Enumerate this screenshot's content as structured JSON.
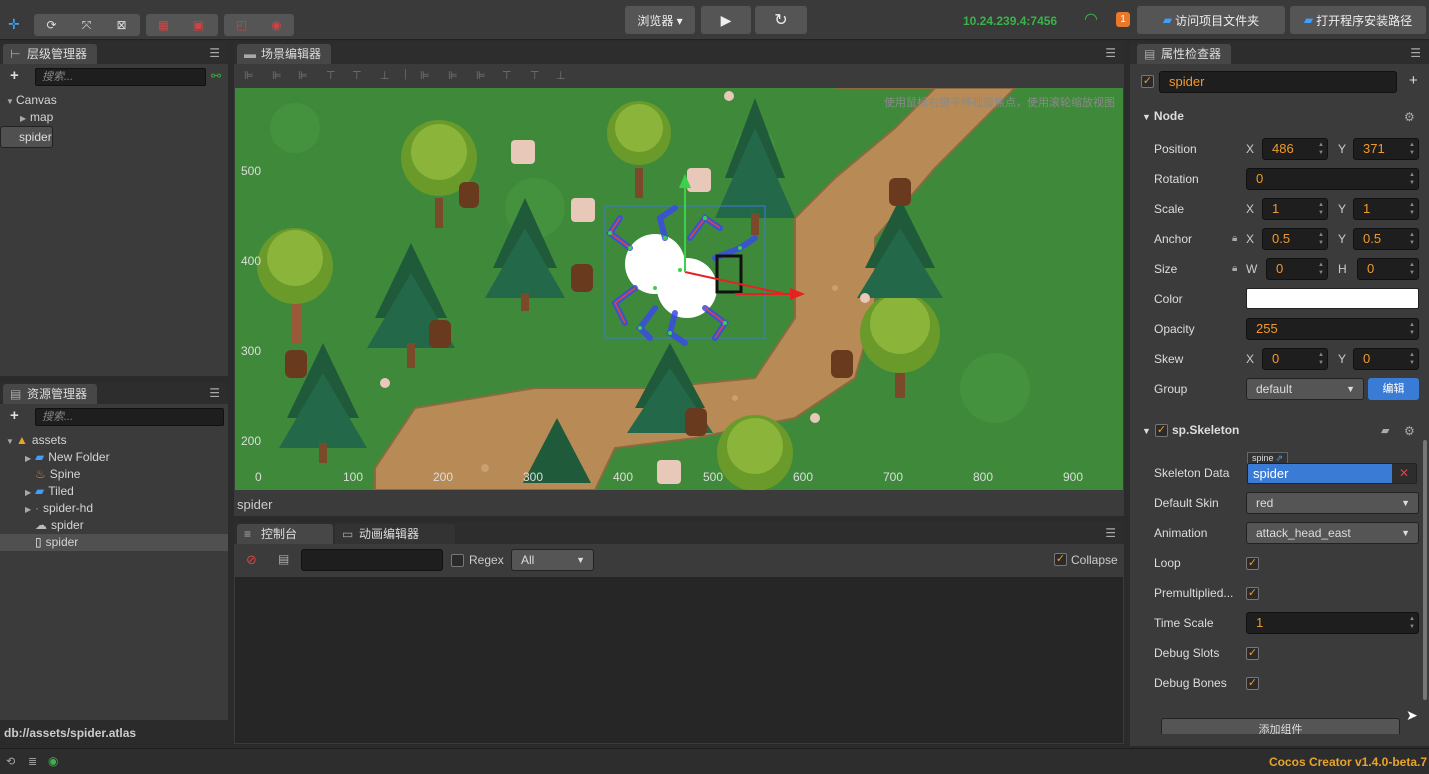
{
  "toolbar": {
    "tool_icons": [
      "move-icon",
      "rotate-icon",
      "scale-icon",
      "rect-icon"
    ],
    "browser_select": "浏览器 ▾",
    "ip": "10.24.239.4:7456",
    "badge": "1",
    "open_project_folder": "访问项目文件夹",
    "open_install_path": "打开程序安装路径"
  },
  "hierarchy": {
    "title": "层级管理器",
    "search_placeholder": "搜索...",
    "nodes": [
      "Canvas",
      "map",
      "spider"
    ]
  },
  "assets": {
    "title": "资源管理器",
    "search_placeholder": "搜索...",
    "items": [
      "assets",
      "New Folder",
      "Spine",
      "Tiled",
      "spider-hd",
      "spider",
      "spider"
    ],
    "path": "db://assets/spider.atlas"
  },
  "scene": {
    "title": "场景编辑器",
    "hint": "使用鼠标右键平移视窗焦点，使用滚轮缩放视图",
    "selected_node": "spider",
    "y_ticks": [
      "500",
      "400",
      "300",
      "200"
    ],
    "x_ticks": [
      "0",
      "100",
      "200",
      "300",
      "400",
      "500",
      "600",
      "700",
      "800",
      "900"
    ]
  },
  "console": {
    "tab_console": "控制台",
    "tab_animation": "动画编辑器",
    "regex_label": "Regex",
    "filter_option": "All",
    "collapse_label": "Collapse"
  },
  "inspector": {
    "title": "属性检查器",
    "node_name": "spider",
    "node_section": "Node",
    "position_label": "Position",
    "pos_x": "486",
    "pos_y": "371",
    "rotation_label": "Rotation",
    "rotation": "0",
    "scale_label": "Scale",
    "scale_x": "1",
    "scale_y": "1",
    "anchor_label": "Anchor",
    "anchor_x": "0.5",
    "anchor_y": "0.5",
    "size_label": "Size",
    "size_w": "0",
    "size_h": "0",
    "color_label": "Color",
    "color_value": "#ffffff",
    "opacity_label": "Opacity",
    "opacity": "255",
    "skew_label": "Skew",
    "skew_x": "0",
    "skew_y": "0",
    "group_label": "Group",
    "group": "default",
    "edit_button": "编辑",
    "x_axis": "X",
    "y_axis": "Y",
    "w_axis": "W",
    "h_axis": "H",
    "skeleton_section": "sp.Skeleton",
    "skeleton_data_label": "Skeleton Data",
    "skeleton_type": "spine",
    "skeleton_data": "spider",
    "default_skin_label": "Default Skin",
    "default_skin": "red",
    "animation_label": "Animation",
    "animation": "attack_head_east",
    "loop_label": "Loop",
    "premultiplied_label": "Premultiplied...",
    "time_scale_label": "Time Scale",
    "time_scale": "1",
    "debug_slots_label": "Debug Slots",
    "debug_bones_label": "Debug Bones",
    "add_component": "添加组件"
  },
  "status": {
    "version": "Cocos Creator v1.4.0-beta.7"
  },
  "colors": {
    "accent": "#f09a2e",
    "selection": "#3a7bd5",
    "grass": "#3f8a3a",
    "path": "#b88a55"
  }
}
